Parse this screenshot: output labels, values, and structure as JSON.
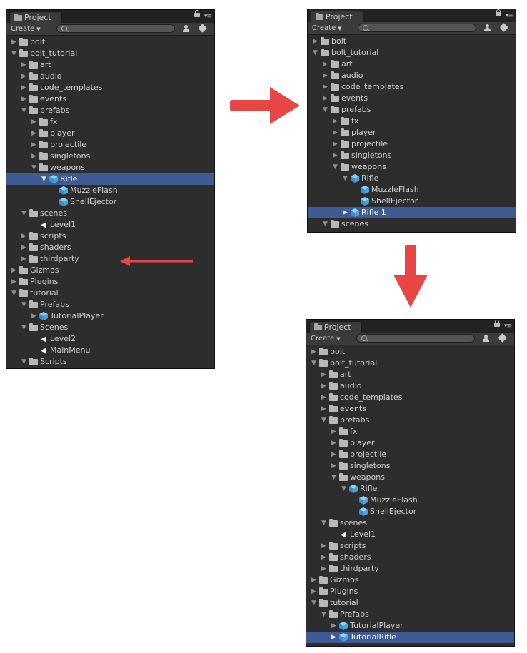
{
  "tab_label": "Project",
  "create_label": "Create",
  "panels": [
    {
      "rows": [
        {
          "depth": 0,
          "state": "closed",
          "icon": "folder",
          "label": "bolt"
        },
        {
          "depth": 0,
          "state": "open",
          "icon": "folder",
          "label": "bolt_tutorial"
        },
        {
          "depth": 1,
          "state": "closed",
          "icon": "folder",
          "label": "art"
        },
        {
          "depth": 1,
          "state": "closed",
          "icon": "folder",
          "label": "audio"
        },
        {
          "depth": 1,
          "state": "closed",
          "icon": "folder",
          "label": "code_templates"
        },
        {
          "depth": 1,
          "state": "closed",
          "icon": "folder",
          "label": "events"
        },
        {
          "depth": 1,
          "state": "open",
          "icon": "folder",
          "label": "prefabs"
        },
        {
          "depth": 2,
          "state": "closed",
          "icon": "folder",
          "label": "fx"
        },
        {
          "depth": 2,
          "state": "closed",
          "icon": "folder",
          "label": "player"
        },
        {
          "depth": 2,
          "state": "closed",
          "icon": "folder",
          "label": "projectile"
        },
        {
          "depth": 2,
          "state": "closed",
          "icon": "folder",
          "label": "singletons"
        },
        {
          "depth": 2,
          "state": "open",
          "icon": "folder",
          "label": "weapons"
        },
        {
          "depth": 3,
          "state": "open",
          "icon": "cube",
          "label": "Rifle",
          "selected": true
        },
        {
          "depth": 4,
          "state": "none",
          "icon": "cube",
          "label": "MuzzleFlash"
        },
        {
          "depth": 4,
          "state": "none",
          "icon": "cube",
          "label": "ShellEjector"
        },
        {
          "depth": 1,
          "state": "open",
          "icon": "folder",
          "label": "scenes"
        },
        {
          "depth": 2,
          "state": "none",
          "icon": "unity",
          "label": "Level1"
        },
        {
          "depth": 1,
          "state": "closed",
          "icon": "folder",
          "label": "scripts"
        },
        {
          "depth": 1,
          "state": "closed",
          "icon": "folder",
          "label": "shaders"
        },
        {
          "depth": 1,
          "state": "closed",
          "icon": "folder",
          "label": "thirdparty"
        },
        {
          "depth": 0,
          "state": "closed",
          "icon": "folder",
          "label": "Gizmos"
        },
        {
          "depth": 0,
          "state": "closed",
          "icon": "folder",
          "label": "Plugins"
        },
        {
          "depth": 0,
          "state": "open",
          "icon": "folder",
          "label": "tutorial"
        },
        {
          "depth": 1,
          "state": "open",
          "icon": "folder",
          "label": "Prefabs"
        },
        {
          "depth": 2,
          "state": "closed",
          "icon": "cube",
          "label": "TutorialPlayer"
        },
        {
          "depth": 1,
          "state": "open",
          "icon": "folder",
          "label": "Scenes"
        },
        {
          "depth": 2,
          "state": "none",
          "icon": "unity",
          "label": "Level2"
        },
        {
          "depth": 2,
          "state": "none",
          "icon": "unity",
          "label": "MainMenu"
        },
        {
          "depth": 1,
          "state": "open",
          "icon": "folder",
          "label": "Scripts"
        }
      ]
    },
    {
      "rows": [
        {
          "depth": 0,
          "state": "closed",
          "icon": "folder",
          "label": "bolt"
        },
        {
          "depth": 0,
          "state": "open",
          "icon": "folder",
          "label": "bolt_tutorial"
        },
        {
          "depth": 1,
          "state": "closed",
          "icon": "folder",
          "label": "art"
        },
        {
          "depth": 1,
          "state": "closed",
          "icon": "folder",
          "label": "audio"
        },
        {
          "depth": 1,
          "state": "closed",
          "icon": "folder",
          "label": "code_templates"
        },
        {
          "depth": 1,
          "state": "closed",
          "icon": "folder",
          "label": "events"
        },
        {
          "depth": 1,
          "state": "open",
          "icon": "folder",
          "label": "prefabs"
        },
        {
          "depth": 2,
          "state": "closed",
          "icon": "folder",
          "label": "fx"
        },
        {
          "depth": 2,
          "state": "closed",
          "icon": "folder",
          "label": "player"
        },
        {
          "depth": 2,
          "state": "closed",
          "icon": "folder",
          "label": "projectile"
        },
        {
          "depth": 2,
          "state": "closed",
          "icon": "folder",
          "label": "singletons"
        },
        {
          "depth": 2,
          "state": "open",
          "icon": "folder",
          "label": "weapons"
        },
        {
          "depth": 3,
          "state": "open",
          "icon": "cube",
          "label": "Rifle"
        },
        {
          "depth": 4,
          "state": "none",
          "icon": "cube",
          "label": "MuzzleFlash"
        },
        {
          "depth": 4,
          "state": "none",
          "icon": "cube",
          "label": "ShellEjector"
        },
        {
          "depth": 3,
          "state": "closed",
          "icon": "cube",
          "label": "Rifle 1",
          "selected": true
        },
        {
          "depth": 1,
          "state": "open",
          "icon": "folder",
          "label": "scenes"
        }
      ]
    },
    {
      "rows": [
        {
          "depth": 0,
          "state": "closed",
          "icon": "folder",
          "label": "bolt"
        },
        {
          "depth": 0,
          "state": "open",
          "icon": "folder",
          "label": "bolt_tutorial"
        },
        {
          "depth": 1,
          "state": "closed",
          "icon": "folder",
          "label": "art"
        },
        {
          "depth": 1,
          "state": "closed",
          "icon": "folder",
          "label": "audio"
        },
        {
          "depth": 1,
          "state": "closed",
          "icon": "folder",
          "label": "code_templates"
        },
        {
          "depth": 1,
          "state": "closed",
          "icon": "folder",
          "label": "events"
        },
        {
          "depth": 1,
          "state": "open",
          "icon": "folder",
          "label": "prefabs"
        },
        {
          "depth": 2,
          "state": "closed",
          "icon": "folder",
          "label": "fx"
        },
        {
          "depth": 2,
          "state": "closed",
          "icon": "folder",
          "label": "player"
        },
        {
          "depth": 2,
          "state": "closed",
          "icon": "folder",
          "label": "projectile"
        },
        {
          "depth": 2,
          "state": "closed",
          "icon": "folder",
          "label": "singletons"
        },
        {
          "depth": 2,
          "state": "open",
          "icon": "folder",
          "label": "weapons"
        },
        {
          "depth": 3,
          "state": "open",
          "icon": "cube",
          "label": "Rifle"
        },
        {
          "depth": 4,
          "state": "none",
          "icon": "cube",
          "label": "MuzzleFlash"
        },
        {
          "depth": 4,
          "state": "none",
          "icon": "cube",
          "label": "ShellEjector"
        },
        {
          "depth": 1,
          "state": "open",
          "icon": "folder",
          "label": "scenes"
        },
        {
          "depth": 2,
          "state": "none",
          "icon": "unity",
          "label": "Level1"
        },
        {
          "depth": 1,
          "state": "closed",
          "icon": "folder",
          "label": "scripts"
        },
        {
          "depth": 1,
          "state": "closed",
          "icon": "folder",
          "label": "shaders"
        },
        {
          "depth": 1,
          "state": "closed",
          "icon": "folder",
          "label": "thirdparty"
        },
        {
          "depth": 0,
          "state": "closed",
          "icon": "folder",
          "label": "Gizmos"
        },
        {
          "depth": 0,
          "state": "closed",
          "icon": "folder",
          "label": "Plugins"
        },
        {
          "depth": 0,
          "state": "open",
          "icon": "folder",
          "label": "tutorial"
        },
        {
          "depth": 1,
          "state": "open",
          "icon": "folder",
          "label": "Prefabs"
        },
        {
          "depth": 2,
          "state": "closed",
          "icon": "cube",
          "label": "TutorialPlayer"
        },
        {
          "depth": 2,
          "state": "closed",
          "icon": "cube",
          "label": "TutorialRifle",
          "selected": true
        }
      ]
    }
  ],
  "colors": {
    "annotation_arrow": "#e84545",
    "selection": "#3e5c93",
    "prefab_cube": "#4aa3df"
  }
}
